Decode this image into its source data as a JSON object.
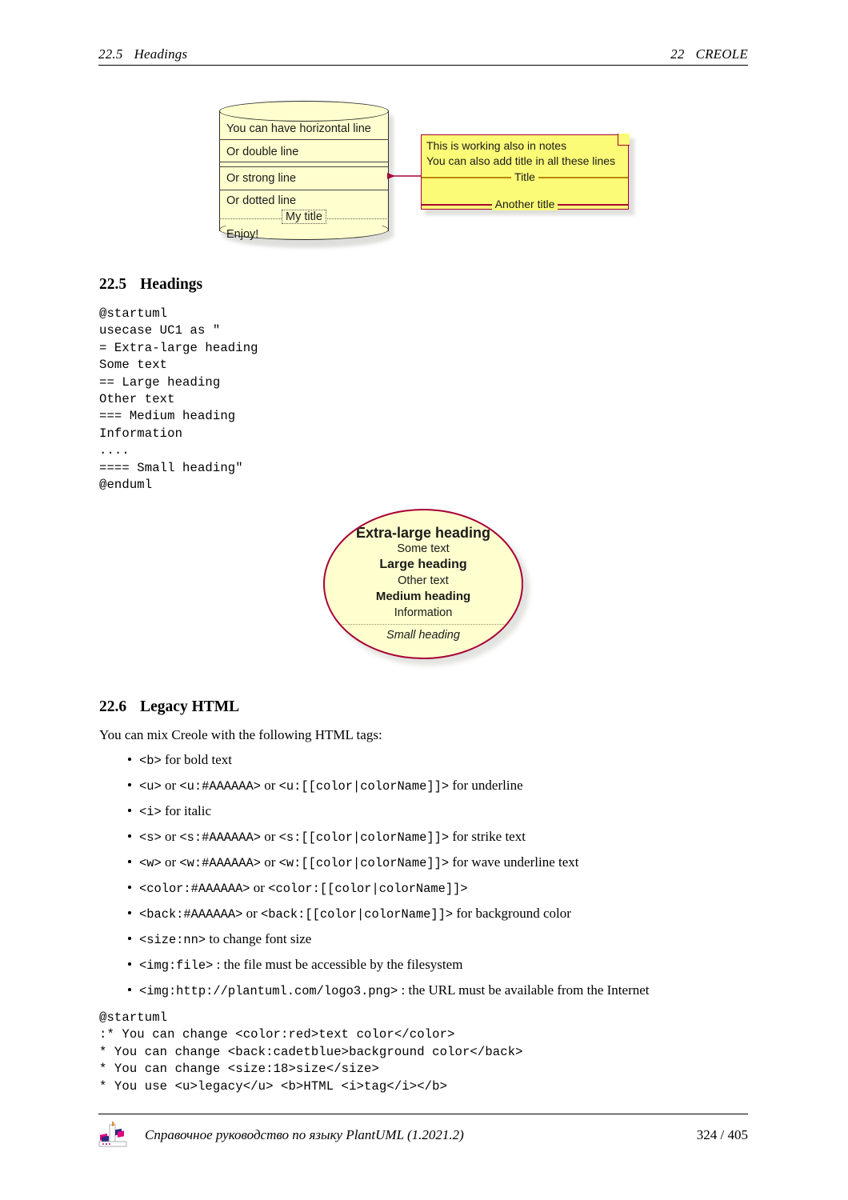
{
  "header": {
    "left_number": "22.5",
    "left_title": "Headings",
    "right_number": "22",
    "right_title": "CREOLE"
  },
  "diagram_database": {
    "rows": [
      "You can have horizontal line",
      "Or double line",
      "Or strong line",
      "Or dotted line",
      "Enjoy!"
    ],
    "inline_title": "My title",
    "fill_color": "#FEFECE",
    "border_color": "#2B2B2B"
  },
  "diagram_note": {
    "line1": "This is working also in notes",
    "line2": "You can also add title in all these lines",
    "title1": "Title",
    "title2": "Another title",
    "fill_color": "#FBFB77",
    "border_color": "#A80036"
  },
  "section_headings": {
    "number": "22.5",
    "title": "Headings"
  },
  "code_headings": "@startuml\nusecase UC1 as \"\n= Extra-large heading\nSome text\n== Large heading\nOther text\n=== Medium heading\nInformation\n....\n==== Small heading\"\n@enduml",
  "diagram_usecase": {
    "extra_large": "Extra-large heading",
    "some_text": "Some text",
    "large": "Large heading",
    "other_text": "Other text",
    "medium": "Medium heading",
    "information": "Information",
    "small": "Small heading",
    "fill_color": "#FEFECE",
    "border_color": "#A80036"
  },
  "section_legacy": {
    "number": "22.6",
    "title": "Legacy HTML"
  },
  "intro_paragraph": "You can mix Creole with the following HTML tags:",
  "bullets": [
    {
      "code1": "<b>",
      "rest": " for bold text"
    },
    {
      "code1": "<u>",
      "mid1": " or ",
      "code2": "<u:#AAAAAA>",
      "mid2": " or ",
      "code3": "<u:[[color|colorName]]>",
      "rest": " for underline"
    },
    {
      "code1": "<i>",
      "rest": " for italic"
    },
    {
      "code1": "<s>",
      "mid1": " or ",
      "code2": "<s:#AAAAAA>",
      "mid2": " or ",
      "code3": "<s:[[color|colorName]]>",
      "rest": " for strike text"
    },
    {
      "code1": "<w>",
      "mid1": " or ",
      "code2": "<w:#AAAAAA>",
      "mid2": " or ",
      "code3": "<w:[[color|colorName]]>",
      "rest": " for wave underline text"
    },
    {
      "code1": "<color:#AAAAAA>",
      "mid1": " or ",
      "code2": "<color:[[color|colorName]]>",
      "rest": ""
    },
    {
      "code1": "<back:#AAAAAA>",
      "mid1": " or ",
      "code2": "<back:[[color|colorName]]>",
      "rest": " for background color"
    },
    {
      "code1": "<size:nn>",
      "rest": " to change font size"
    },
    {
      "code1": "<img:file>",
      "rest": " : the file must be accessible by the filesystem"
    },
    {
      "code1": "<img:http://plantuml.com/logo3.png>",
      "rest": " : the URL must be available from the Internet"
    }
  ],
  "code_legacy": "@startuml\n:* You can change <color:red>text color</color>\n* You can change <back:cadetblue>background color</back>\n* You can change <size:18>size</size>\n* You use <u>legacy</u> <b>HTML <i>tag</i></b>",
  "footer": {
    "title": "Справочное руководство по языку PlantUML (1.2021.2)",
    "page": "324 / 405"
  }
}
